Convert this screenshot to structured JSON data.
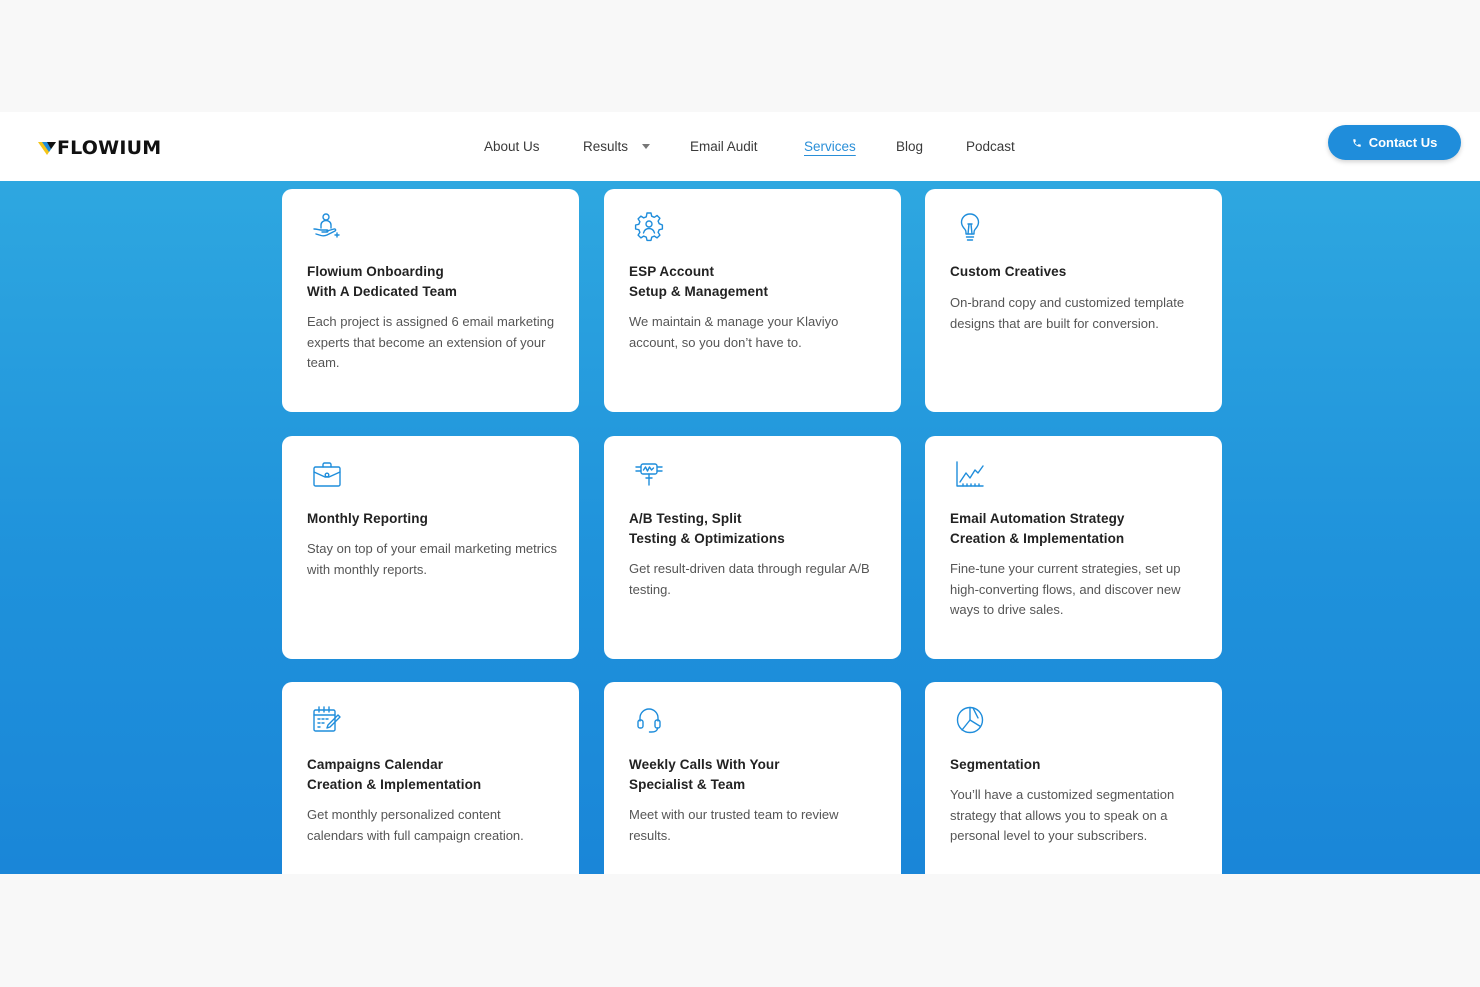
{
  "brand": {
    "name": "FLOWIUM"
  },
  "nav": {
    "items": [
      {
        "label": "About Us"
      },
      {
        "label": "Results"
      },
      {
        "label": "Email Audit"
      },
      {
        "label": "Services"
      },
      {
        "label": "Blog"
      },
      {
        "label": "Podcast"
      }
    ],
    "active": "Services",
    "contact_label": "Contact Us"
  },
  "colors": {
    "accent": "#1f8ddb",
    "hero_top": "#2ea7e0",
    "hero_bottom": "#1a86d8",
    "logo_yellow": "#f5c518"
  },
  "services": [
    {
      "icon": "hand-person-icon",
      "title1": "Flowium Onboarding",
      "title2": "With A Dedicated Team",
      "desc": "Each project is assigned 6 email marketing experts that become an extension of your team."
    },
    {
      "icon": "gear-person-icon",
      "title1": "ESP Account",
      "title2": "Setup & Management",
      "desc": "We maintain & manage your Klaviyo account, so you don’t have to."
    },
    {
      "icon": "lightbulb-icon",
      "title1": "Custom Creatives",
      "title2": "",
      "desc": "On-brand copy and customized template designs that are built for conversion."
    },
    {
      "icon": "briefcase-icon",
      "title1": "Monthly Reporting",
      "title2": "",
      "desc": "Stay on top of your email marketing metrics with monthly reports."
    },
    {
      "icon": "ab-testing-icon",
      "title1": "A/B Testing, Split",
      "title2": "Testing & Optimizations",
      "desc": "Get result-driven data through regular A/B testing."
    },
    {
      "icon": "line-chart-icon",
      "title1": "Email Automation Strategy",
      "title2": "Creation & Implementation",
      "desc": "Fine-tune your current strategies, set up high-converting flows, and discover new ways to drive sales."
    },
    {
      "icon": "calendar-edit-icon",
      "title1": "Campaigns Calendar",
      "title2": "Creation & Implementation",
      "desc": "Get monthly personalized content calendars with full campaign creation."
    },
    {
      "icon": "headset-icon",
      "title1": "Weekly Calls With Your",
      "title2": "Specialist & Team",
      "desc": "Meet with our trusted team to review results."
    },
    {
      "icon": "pie-chart-icon",
      "title1": "Segmentation",
      "title2": "",
      "desc": "You’ll have a customized segmentation strategy that allows you to speak on a personal level to your subscribers."
    }
  ]
}
